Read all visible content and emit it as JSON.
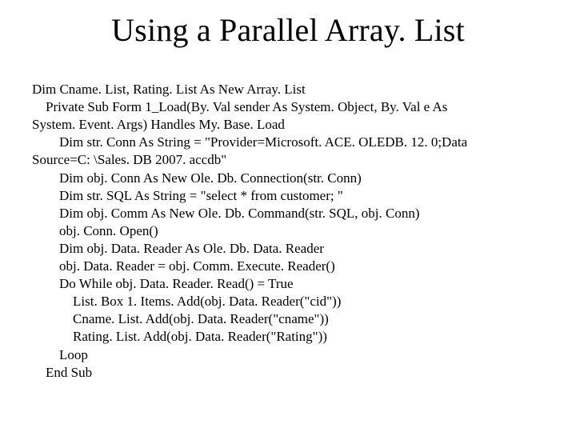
{
  "title": "Using a Parallel Array. List",
  "code": {
    "l0": "Dim Cname. List, Rating. List As New Array. List",
    "l1": "    Private Sub Form 1_Load(By. Val sender As System. Object, By. Val e As",
    "l2": "System. Event. Args) Handles My. Base. Load",
    "l3": "        Dim str. Conn As String = \"Provider=Microsoft. ACE. OLEDB. 12. 0;Data",
    "l4": "Source=C: \\Sales. DB 2007. accdb\"",
    "l5": "        Dim obj. Conn As New Ole. Db. Connection(str. Conn)",
    "l6": "        Dim str. SQL As String = \"select * from customer; \"",
    "l7": "        Dim obj. Comm As New Ole. Db. Command(str. SQL, obj. Conn)",
    "l8": "        obj. Conn. Open()",
    "l9": "        Dim obj. Data. Reader As Ole. Db. Data. Reader",
    "l10": "        obj. Data. Reader = obj. Comm. Execute. Reader()",
    "l11": "        Do While obj. Data. Reader. Read() = True",
    "l12": "            List. Box 1. Items. Add(obj. Data. Reader(\"cid\"))",
    "l13": "            Cname. List. Add(obj. Data. Reader(\"cname\"))",
    "l14": "            Rating. List. Add(obj. Data. Reader(\"Rating\"))",
    "l15": "        Loop",
    "l16": "    End Sub"
  }
}
